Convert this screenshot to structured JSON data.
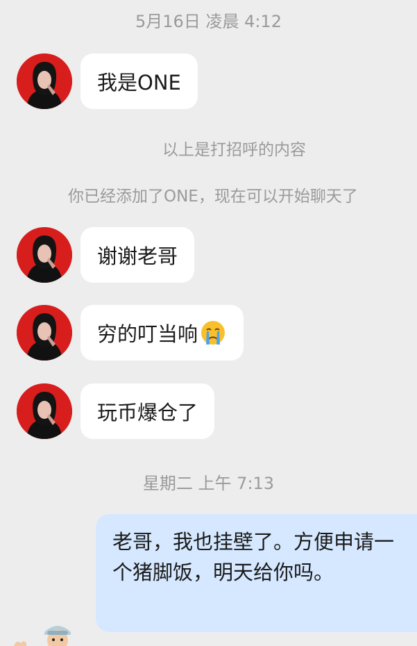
{
  "chat": {
    "timestamp_1": "5月16日 凌晨 4:12",
    "timestamp_2": "星期二 上午 7:13",
    "system_notes": [
      "以上是打招呼的内容",
      "你已经添加了ONE，现在可以开始聊天了"
    ],
    "messages": [
      {
        "sender": "ONE",
        "text": "我是ONE"
      },
      {
        "sender": "ONE",
        "text": "谢谢老哥"
      },
      {
        "sender": "ONE",
        "text": "穷的叮当响",
        "emoji": "crying-face-icon"
      },
      {
        "sender": "ONE",
        "text": "玩币爆仓了"
      },
      {
        "sender": "me",
        "text": "老哥，我也挂壁了。方便申请一个猪脚饭，明天给你吗。"
      }
    ]
  },
  "colors": {
    "background": "#ededed",
    "incoming_bubble": "#ffffff",
    "outgoing_bubble": "#d5e8ff",
    "meta_text": "#9a9a9a",
    "avatar_bg": "#d81d1d"
  }
}
